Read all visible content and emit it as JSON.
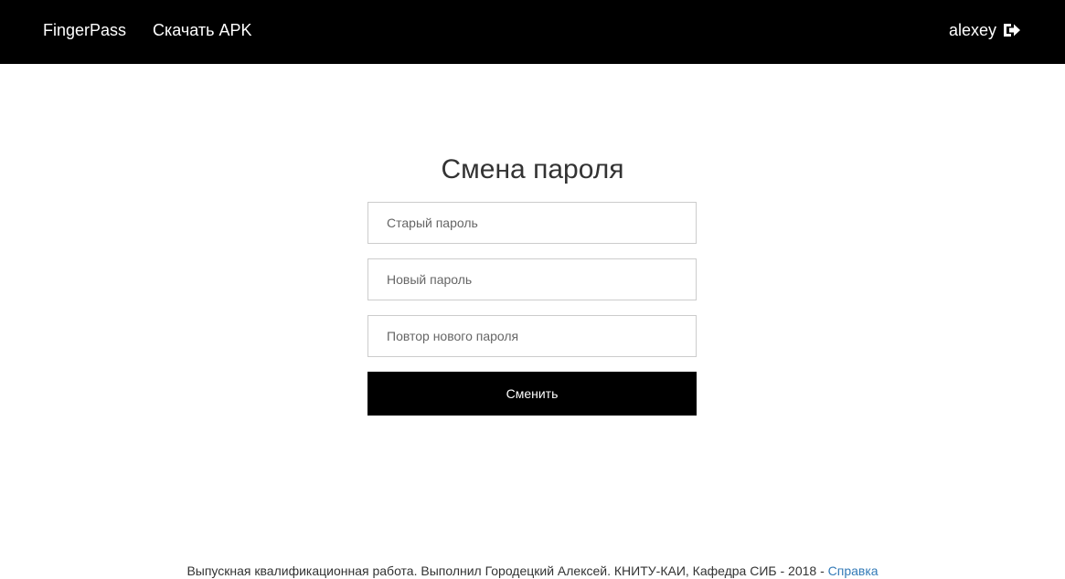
{
  "navbar": {
    "brand": "FingerPass",
    "download_link": "Скачать APK",
    "username": "alexey",
    "logout_icon": "sign-out-icon"
  },
  "form": {
    "title": "Смена пароля",
    "old_password_placeholder": "Старый пароль",
    "new_password_placeholder": "Новый пароль",
    "repeat_password_placeholder": "Повтор нового пароля",
    "submit_label": "Сменить"
  },
  "footer": {
    "text": "Выпускная квалификационная работа. Выполнил Городецкий Алексей. КНИТУ-КАИ, Кафедра СИБ - 2018 - ",
    "help_link": "Справка"
  },
  "colors": {
    "navbar_bg": "#000000",
    "button_bg": "#000000",
    "link": "#337ab7"
  }
}
